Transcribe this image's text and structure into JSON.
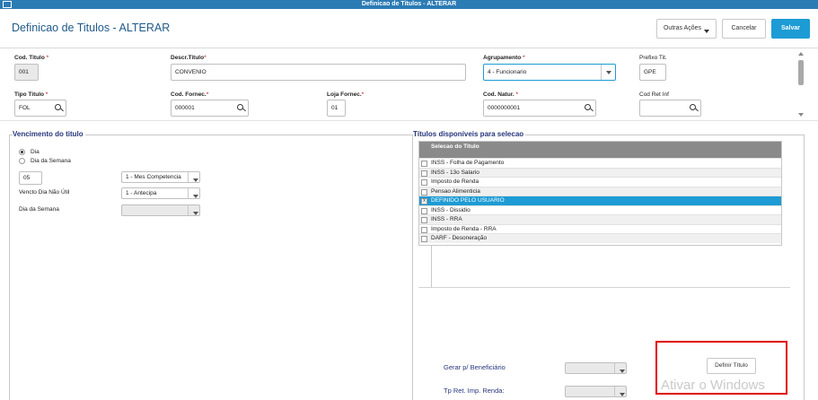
{
  "window": {
    "title": "Definicao de Titulos - ALTERAR"
  },
  "header": {
    "page_title": "Definicao de Titulos - ALTERAR",
    "other_actions_label": "Outras Ações",
    "cancel_label": "Cancelar",
    "save_label": "Salvar"
  },
  "form": {
    "cod_titulo": {
      "label": "Cod. Titulo",
      "required": "*",
      "value": "001"
    },
    "descr_titulo": {
      "label": "Descr.Titulo",
      "required": "*",
      "value": "CONVENIO"
    },
    "agrupamento": {
      "label": "Agrupamento",
      "required": "*",
      "value": "4 - Funcionario"
    },
    "prefixo_tit": {
      "label": "Prefixo Tit.",
      "value": "GPE"
    },
    "tipo_titulo": {
      "label": "Tipo Titulo",
      "required": "*",
      "value": "FOL"
    },
    "cod_fornec": {
      "label": "Cod. Fornec.",
      "required": "*",
      "value": "000001"
    },
    "loja_fornec": {
      "label": "Loja Fornec.",
      "required": "*",
      "value": "01"
    },
    "cod_natur": {
      "label": "Cod. Natur.",
      "required": "*",
      "value": "0000000001"
    },
    "cod_ret_inf": {
      "label": "Cod Ret Inf",
      "value": ""
    }
  },
  "vencimento": {
    "group_title": "Vencimento do titulo",
    "radio_dia": "Dia",
    "radio_dia_semana": "Dia da Semana",
    "dia_value": "05",
    "competencia_value": "1 - Mes Competencia",
    "dia_nao_util_label": "Vencto Dia Não Útil",
    "dia_nao_util_value": "1 - Antecipa",
    "dia_semana_label": "Dia da Semana",
    "dia_semana_value": ""
  },
  "titulos": {
    "group_title": "Títulos disponíveis para selecao",
    "column_header": "Selecao do Titulo",
    "rows": [
      {
        "label": "INSS - Folha de Pagamento",
        "checked": ""
      },
      {
        "label": "INSS - 13o Salario",
        "checked": ""
      },
      {
        "label": "Imposto de Renda",
        "checked": ""
      },
      {
        "label": "Pensao Alimenticia",
        "checked": ""
      },
      {
        "label": "DEFINIDO PELO USUARIO",
        "checked": "x"
      },
      {
        "label": "INSS - Dissidio",
        "checked": ""
      },
      {
        "label": "INSS - RRA",
        "checked": ""
      },
      {
        "label": "Imposto de Renda - RRA",
        "checked": ""
      },
      {
        "label": "DARF - Desoneração",
        "checked": ""
      }
    ],
    "gerar_label": "Gerar p/ Beneficiário",
    "gerar_value": "",
    "tp_ret_label": "Tp Ret. Imp. Renda:",
    "tp_ret_value": "",
    "definir_button": "Definir Título"
  },
  "watermark": "Ativar o Windows"
}
